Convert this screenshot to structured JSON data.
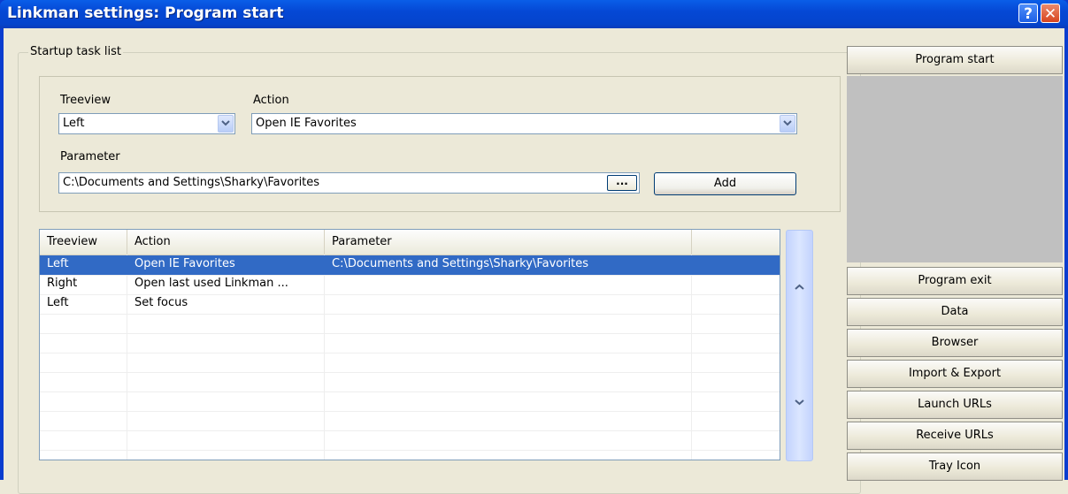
{
  "window": {
    "title": "Linkman settings: Program start",
    "help_glyph": "?",
    "close_glyph": "✕"
  },
  "startup": {
    "group_label": "Startup task list",
    "treeview_label": "Treeview",
    "treeview_value": "Left",
    "action_label": "Action",
    "action_value": "Open IE Favorites",
    "parameter_label": "Parameter",
    "parameter_value": "C:\\Documents and Settings\\Sharky\\Favorites",
    "browse_label": "...",
    "add_label": "Add"
  },
  "table": {
    "columns": [
      "Treeview",
      "Action",
      "Parameter"
    ],
    "rows": [
      {
        "treeview": "Left",
        "action": "Open IE Favorites",
        "parameter": "C:\\Documents and Settings\\Sharky\\Favorites",
        "selected": true
      },
      {
        "treeview": "Right",
        "action": "Open last used Linkman ...",
        "parameter": "",
        "selected": false
      },
      {
        "treeview": "Left",
        "action": "Set focus",
        "parameter": "",
        "selected": false
      }
    ]
  },
  "nav": {
    "items": [
      "Program start",
      "Program exit",
      "Data",
      "Browser",
      "Import & Export",
      "Launch URLs",
      "Receive URLs",
      "Tray Icon"
    ]
  },
  "colors": {
    "selection": "#316ac5",
    "titlebar": "#0548d5"
  }
}
